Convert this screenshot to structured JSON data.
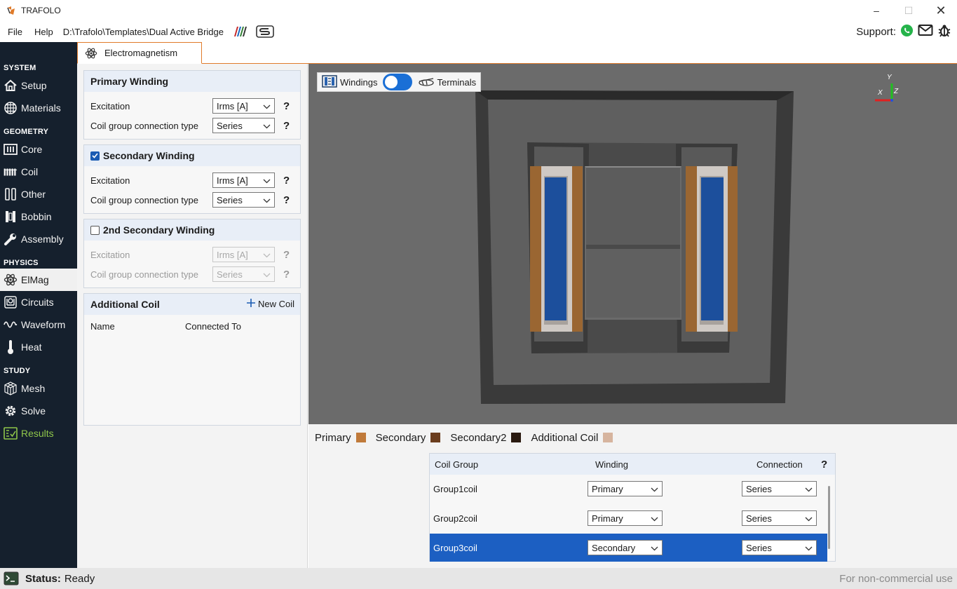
{
  "window": {
    "title": "TRAFOLO",
    "min_icon": "minimize-icon",
    "max_icon": "maximize-icon",
    "close_icon": "close-icon"
  },
  "menu": {
    "file": "File",
    "help": "Help",
    "path": "D:\\Trafolo\\Templates\\Dual Active Bridge",
    "support_label": "Support:"
  },
  "sidebar": {
    "sections": {
      "system": "SYSTEM",
      "geometry": "GEOMETRY",
      "physics": "PHYSICS",
      "study": "STUDY"
    },
    "items": {
      "setup": "Setup",
      "materials": "Materials",
      "core": "Core",
      "coil": "Coil",
      "other": "Other",
      "bobbin": "Bobbin",
      "assembly": "Assembly",
      "elmag": "ElMag",
      "circuits": "Circuits",
      "waveform": "Waveform",
      "heat": "Heat",
      "mesh": "Mesh",
      "solve": "Solve",
      "results": "Results"
    }
  },
  "tab": {
    "label": "Electromagnetism"
  },
  "primary": {
    "title": "Primary Winding",
    "excitation_label": "Excitation",
    "excitation_value": "Irms [A]",
    "connection_label": "Coil group connection type",
    "connection_value": "Series",
    "help": "?"
  },
  "secondary": {
    "title": "Secondary Winding",
    "checked": true,
    "excitation_label": "Excitation",
    "excitation_value": "Irms [A]",
    "connection_label": "Coil group connection type",
    "connection_value": "Series",
    "help": "?"
  },
  "secondary2": {
    "title": "2nd Secondary Winding",
    "checked": false,
    "excitation_label": "Excitation",
    "excitation_value": "Irms [A]",
    "connection_label": "Coil group connection type",
    "connection_value": "Series",
    "help": "?"
  },
  "additional": {
    "title": "Additional Coil",
    "new_coil": "New Coil",
    "col_name": "Name",
    "col_connected": "Connected To"
  },
  "viewport": {
    "windings_label": "Windings",
    "terminals_label": "Terminals",
    "axis_x": "X",
    "axis_y": "Y",
    "axis_z": "Z"
  },
  "legend": {
    "primary": "Primary",
    "secondary": "Secondary",
    "secondary2": "Secondary2",
    "additional": "Additional Coil",
    "colors": {
      "primary": "#c07a3a",
      "secondary": "#6b3d1e",
      "secondary2": "#2a1a10",
      "additional": "#d6b49e"
    }
  },
  "coil_groups": {
    "col_group": "Coil Group",
    "col_winding": "Winding",
    "col_connection": "Connection",
    "help": "?",
    "rows": [
      {
        "group": "Group1coil",
        "winding": "Primary",
        "connection": "Series"
      },
      {
        "group": "Group2coil",
        "winding": "Primary",
        "connection": "Series"
      },
      {
        "group": "Group3coil",
        "winding": "Secondary",
        "connection": "Series"
      }
    ]
  },
  "status": {
    "label": "Status:",
    "value": "Ready",
    "license": "For non-commercial use"
  }
}
